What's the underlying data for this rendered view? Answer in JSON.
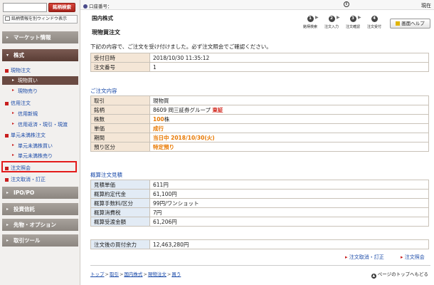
{
  "sidebar": {
    "search_placeholder": "",
    "search_button": "銘柄検索",
    "new_window_link": "銘柄情報を別ウィンドウ表示",
    "market_info": "マーケット情報",
    "stocks": "株式",
    "items": [
      {
        "label": "現物注文",
        "type": "cat"
      },
      {
        "label": "現物買い",
        "type": "sub-active"
      },
      {
        "label": "現物売り",
        "type": "sub"
      },
      {
        "label": "信用注文",
        "type": "cat"
      },
      {
        "label": "信用新規",
        "type": "sub"
      },
      {
        "label": "信用返済・現引・現渡",
        "type": "sub"
      },
      {
        "label": "単元未満株注文",
        "type": "cat"
      },
      {
        "label": "単元未満株買い",
        "type": "sub"
      },
      {
        "label": "単元未満株売り",
        "type": "sub"
      },
      {
        "label": "注文照会",
        "type": "cat"
      },
      {
        "label": "注文取消・訂正",
        "type": "cat"
      }
    ],
    "ipo_po": "IPO/PO",
    "investment_trust": "投資信託",
    "futures_options": "先物・オプション",
    "trading_tools": "取引ツール"
  },
  "topbar": {
    "account_label": "口座番号：",
    "now": "現在"
  },
  "header": {
    "category": "国内株式",
    "title": "現物買注文",
    "steps": [
      {
        "num": "1",
        "label": "銘柄検索"
      },
      {
        "num": "2",
        "label": "注文入力"
      },
      {
        "num": "3",
        "label": "注文確認"
      },
      {
        "num": "4",
        "label": "注文受付"
      }
    ],
    "help_button": "画面ヘルプ"
  },
  "notice": "下記の内容で、ご注文を受け付けました。必ず注文照会でご確認ください。",
  "receipt": [
    {
      "key": "受付日時",
      "value": "2018/10/30 11:35:12"
    },
    {
      "key": "注文番号",
      "value": "1"
    }
  ],
  "order_section_title": "ご注文内容",
  "order": {
    "trade_k": "取引",
    "trade_v": "現物買",
    "stock_k": "銘柄",
    "stock_v": "8609 岡三証券グループ",
    "stock_market": "東証",
    "qty_k": "株数",
    "qty_v": "100",
    "qty_unit": "株",
    "price_k": "単価",
    "price_v": "成行",
    "period_k": "期間",
    "period_v": "当日中 2018/10/30(火)",
    "custody_k": "預り区分",
    "custody_v": "特定預り"
  },
  "estimate_section_title": "概算注文見積",
  "estimate": [
    {
      "key": "見積単価",
      "value": "611円"
    },
    {
      "key": "概算約定代金",
      "value": "61,100円"
    },
    {
      "key": "概算手数料/区分",
      "value": "99円/ワンショット"
    },
    {
      "key": "概算消費税",
      "value": "7円"
    },
    {
      "key": "概算受渡金額",
      "value": "61,206円"
    }
  ],
  "buying_power": {
    "key": "注文後の買付余力",
    "value": "12,463,280円"
  },
  "links": {
    "cancel_modify": "注文取消・訂正",
    "order_inquiry": "注文照会"
  },
  "breadcrumb": [
    "トップ",
    "取引",
    "国内株式",
    "現物注文",
    "買う"
  ],
  "page_top": "ページのトップへもどる"
}
